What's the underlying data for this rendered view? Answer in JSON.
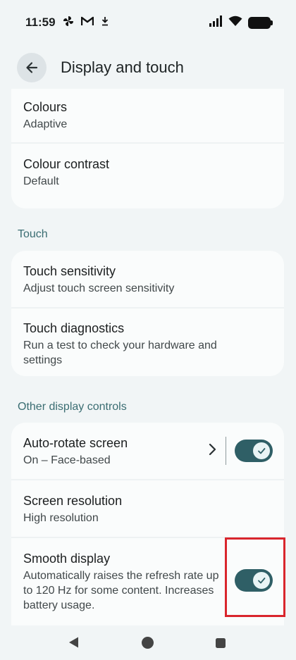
{
  "status_bar": {
    "time": "11:59",
    "icons": [
      "pinwheel-icon",
      "gmail-icon",
      "download-icon",
      "signal-icon",
      "wifi-icon",
      "battery-icon"
    ]
  },
  "app_bar": {
    "title": "Display and touch",
    "back_icon": "arrow-back-icon"
  },
  "display_card": {
    "items": [
      {
        "title": "Colours",
        "subtitle": "Adaptive"
      },
      {
        "title": "Colour contrast",
        "subtitle": "Default"
      }
    ]
  },
  "touch_section": {
    "header": "Touch",
    "items": [
      {
        "title": "Touch sensitivity",
        "subtitle": "Adjust touch screen sensitivity"
      },
      {
        "title": "Touch diagnostics",
        "subtitle": "Run a test to check your hardware and settings"
      }
    ]
  },
  "other_section": {
    "header": "Other display controls",
    "auto_rotate": {
      "title": "Auto-rotate screen",
      "subtitle": "On – Face-based",
      "enabled": true
    },
    "screen_resolution": {
      "title": "Screen resolution",
      "subtitle": "High resolution"
    },
    "smooth_display": {
      "title": "Smooth display",
      "subtitle": "Automatically raises the refresh rate up to 120 Hz for some content. Increases battery usage.",
      "enabled": true
    }
  },
  "colors": {
    "toggle_on": "#2f5f66",
    "section_header": "#3a6d72",
    "highlight": "#d9262d",
    "background": "#f1f5f6",
    "card": "#fafcfc"
  },
  "nav_bar": {
    "icons": [
      "back-triangle-icon",
      "home-circle-icon",
      "recents-square-icon"
    ]
  }
}
